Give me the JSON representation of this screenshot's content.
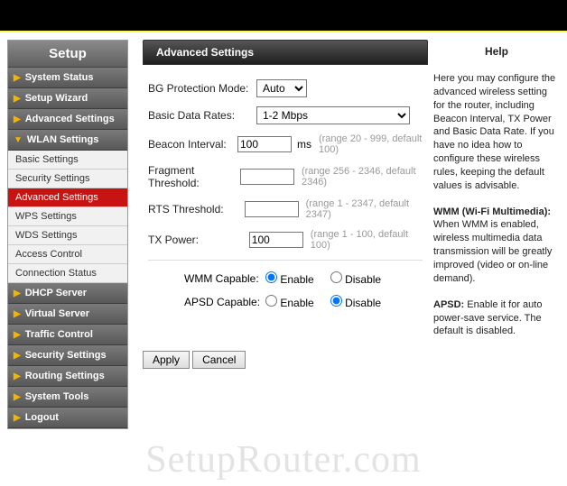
{
  "sidebar": {
    "title": "Setup",
    "items": [
      {
        "label": "System Status"
      },
      {
        "label": "Setup Wizard"
      },
      {
        "label": "Advanced Settings"
      },
      {
        "label": "WLAN Settings",
        "expanded": true,
        "children": [
          {
            "label": "Basic Settings"
          },
          {
            "label": "Security Settings"
          },
          {
            "label": "Advanced Settings",
            "active": true
          },
          {
            "label": "WPS Settings"
          },
          {
            "label": "WDS Settings"
          },
          {
            "label": "Access Control"
          },
          {
            "label": "Connection Status"
          }
        ]
      },
      {
        "label": "DHCP Server"
      },
      {
        "label": "Virtual Server"
      },
      {
        "label": "Traffic Control"
      },
      {
        "label": "Security Settings"
      },
      {
        "label": "Routing Settings"
      },
      {
        "label": "System Tools"
      },
      {
        "label": "Logout"
      }
    ]
  },
  "panel": {
    "title": "Advanced Settings",
    "fields": {
      "bg_protection": {
        "label": "BG Protection Mode:",
        "value": "Auto"
      },
      "basic_data_rates": {
        "label": "Basic Data Rates:",
        "value": "1-2 Mbps"
      },
      "beacon_interval": {
        "label": "Beacon Interval:",
        "value": "100",
        "unit": "ms",
        "hint": "(range 20 - 999, default 100)"
      },
      "fragment_threshold": {
        "label": "Fragment Threshold:",
        "value": "",
        "hint": "(range 256 - 2346, default 2346)"
      },
      "rts_threshold": {
        "label": "RTS Threshold:",
        "value": "",
        "hint": "(range 1 - 2347, default 2347)"
      },
      "tx_power": {
        "label": "TX Power:",
        "value": "100",
        "hint": "(range 1 - 100, default 100)"
      }
    },
    "radios": {
      "wmm": {
        "label": "WMM Capable:",
        "enable": "Enable",
        "disable": "Disable",
        "value": "enable"
      },
      "apsd": {
        "label": "APSD Capable:",
        "enable": "Enable",
        "disable": "Disable",
        "value": "disable"
      }
    },
    "buttons": {
      "apply": "Apply",
      "cancel": "Cancel"
    }
  },
  "help": {
    "title": "Help",
    "p1": "Here you may configure the advanced wireless setting for the router, including Beacon Interval, TX Power and Basic Data Rate. If you have no idea how to configure these wireless rules, keeping the default values is advisable.",
    "p2a": "WMM (Wi-Fi Multimedia):",
    "p2b": " When WMM is enabled, wireless multimedia data transmission will be greatly improved (video or on-line demand).",
    "p3a": "APSD:",
    "p3b": " Enable it for auto power-save service. The default is disabled."
  },
  "watermark": "SetupRouter.com"
}
